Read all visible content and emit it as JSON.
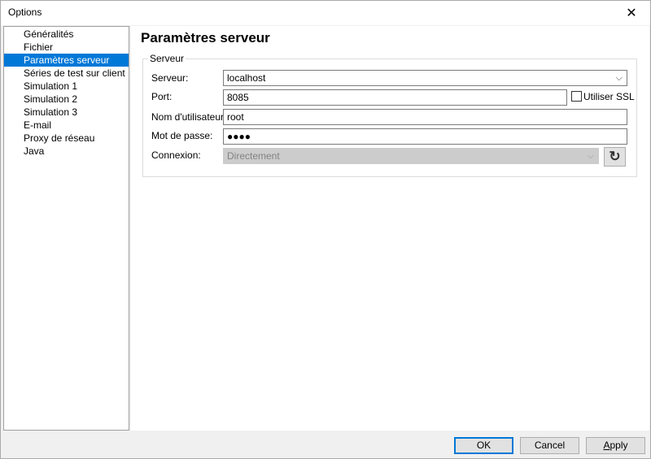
{
  "window": {
    "title": "Options",
    "close_glyph": "✕"
  },
  "sidebar": {
    "items": [
      {
        "label": "Généralités"
      },
      {
        "label": "Fichier"
      },
      {
        "label": "Paramètres serveur"
      },
      {
        "label": "Séries de test sur client"
      },
      {
        "label": "Simulation 1"
      },
      {
        "label": "Simulation 2"
      },
      {
        "label": "Simulation 3"
      },
      {
        "label": "E-mail"
      },
      {
        "label": "Proxy de réseau"
      },
      {
        "label": "Java"
      }
    ],
    "selected_index": 2,
    "selection_color": "#0078d7"
  },
  "main": {
    "title": "Paramètres serveur",
    "group": {
      "legend": "Serveur",
      "server_label": "Serveur:",
      "server_value": "localhost",
      "port_label": "Port:",
      "port_value": "8085",
      "ssl_label": "Utiliser SSL",
      "ssl_checked": false,
      "username_label": "Nom d'utilisateur:",
      "username_value": "root",
      "password_label": "Mot de passe:",
      "password_value": "●●●●",
      "connection_label": "Connexion:",
      "connection_value": "Directement",
      "refresh_glyph": "↻",
      "dropdown_glyph": "⌵"
    }
  },
  "footer": {
    "ok_label": "OK",
    "cancel_label": "Cancel",
    "apply_label": "pply",
    "apply_mnemonic": "A"
  },
  "colors": {
    "accent": "#0078d7",
    "disabled_bg": "#cccccc",
    "dialog_bg": "#f0f0f0"
  }
}
